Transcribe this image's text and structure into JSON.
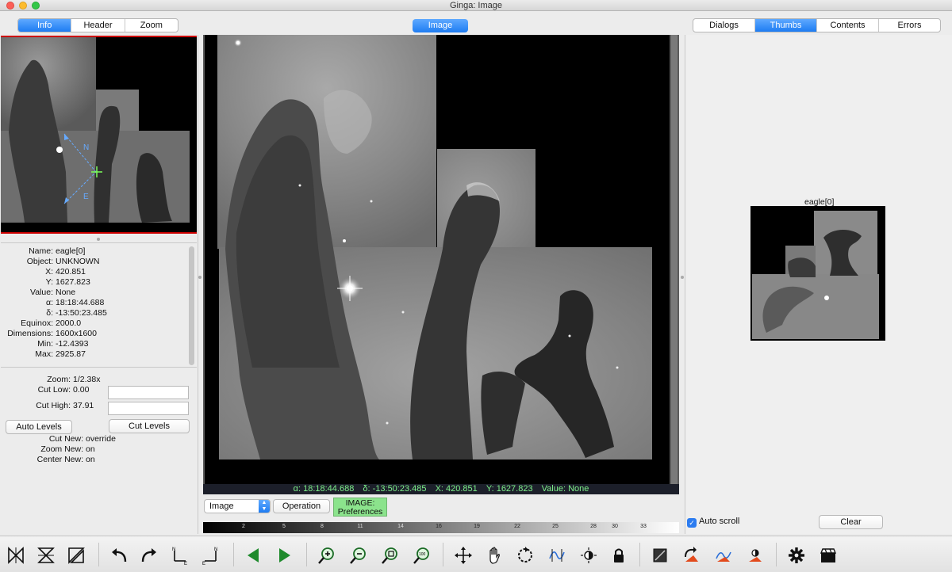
{
  "window": {
    "title": "Ginga: Image"
  },
  "left_tabs": [
    {
      "label": "Info",
      "active": true
    },
    {
      "label": "Header",
      "active": false
    },
    {
      "label": "Zoom",
      "active": false
    }
  ],
  "center_tab": {
    "label": "Image"
  },
  "right_tabs": [
    {
      "label": "Dialogs",
      "active": false
    },
    {
      "label": "Thumbs",
      "active": true
    },
    {
      "label": "Contents",
      "active": false
    },
    {
      "label": "Errors",
      "active": false
    }
  ],
  "pan": {
    "north_label": "N",
    "east_label": "E"
  },
  "info": {
    "rows": [
      {
        "label": "Name:",
        "value": "eagle[0]"
      },
      {
        "label": "Object:",
        "value": "UNKNOWN"
      },
      {
        "label": "X:",
        "value": "420.851"
      },
      {
        "label": "Y:",
        "value": "1627.823"
      },
      {
        "label": "Value:",
        "value": "None"
      },
      {
        "label": "α:",
        "value": "18:18:44.688"
      },
      {
        "label": "δ:",
        "value": "-13:50:23.485"
      },
      {
        "label": "Equinox:",
        "value": "2000.0"
      },
      {
        "label": "Dimensions:",
        "value": "1600x1600"
      },
      {
        "label": "Min:",
        "value": "-12.4393"
      },
      {
        "label": "Max:",
        "value": "2925.87"
      }
    ]
  },
  "zoom": {
    "zoom_label": "Zoom:",
    "zoom_value": "1/2.38x",
    "cut_low_label": "Cut Low:",
    "cut_low_value": "0.00",
    "cut_high_label": "Cut High:",
    "cut_high_value": "37.91",
    "auto_levels": "Auto Levels",
    "cut_levels": "Cut Levels",
    "cut_new_label": "Cut New:",
    "cut_new_value": "override",
    "zoom_new_label": "Zoom New:",
    "zoom_new_value": "on",
    "center_new_label": "Center New:",
    "center_new_value": "on"
  },
  "readout": {
    "alpha": "α: 18:18:44.688",
    "delta": "δ: -13:50:23.485",
    "x": "X: 420.851",
    "y": "Y: 1627.823",
    "value": "Value: None"
  },
  "controls": {
    "mode_select": "Image",
    "operation": "Operation",
    "prefs_line1": "IMAGE:",
    "prefs_line2": "Preferences"
  },
  "colorbar": {
    "ticks": [
      "2",
      "5",
      "8",
      "11",
      "14",
      "16",
      "19",
      "22",
      "25",
      "28",
      "30",
      "33"
    ]
  },
  "thumbs": {
    "label": "eagle[0]",
    "autoscroll": "Auto scroll",
    "clear": "Clear"
  },
  "toolbar_icons": [
    "flip-x-icon",
    "flip-y-icon",
    "swap-xy-icon",
    "rotate-ccw-icon",
    "rotate-cw-icon",
    "orient-ne-icon",
    "orient-nw-icon",
    "prev-image-icon",
    "next-image-icon",
    "zoom-in-icon",
    "zoom-out-icon",
    "zoom-fit-icon",
    "zoom-100-icon",
    "pan-icon",
    "hand-icon",
    "reset-rotation-icon",
    "contrast-icon",
    "brightness-icon",
    "lock-icon",
    "cut-levels-icon",
    "reset-colormap-icon",
    "reset-contrast-icon",
    "reset-all-icon",
    "settings-icon",
    "preferences-icon"
  ],
  "colors": {
    "accent": "#1e7cf2",
    "readout_text": "#7ef08a",
    "readout_bg": "#1c1f2a",
    "prefs_bg": "#8be38c"
  }
}
